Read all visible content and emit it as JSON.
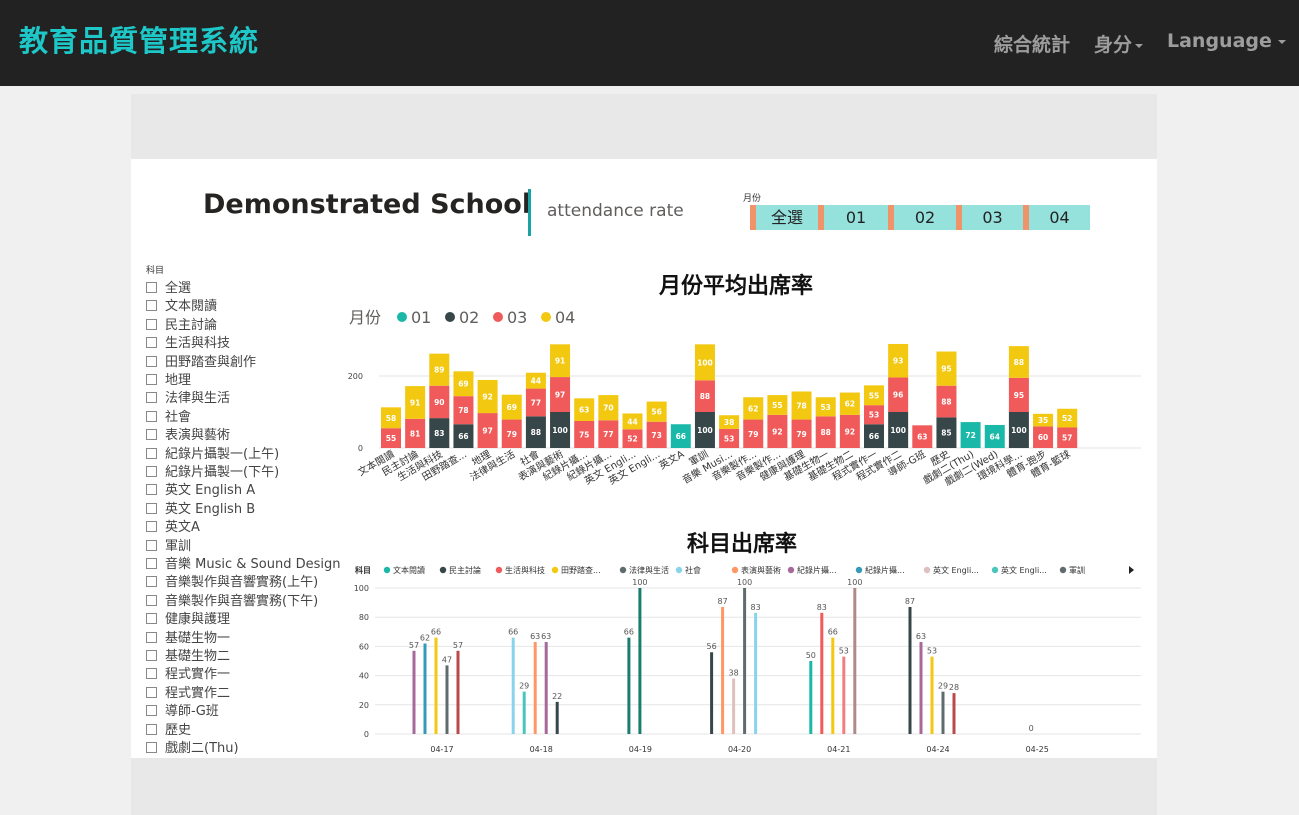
{
  "header": {
    "brand": "教育品質管理系統",
    "nav": [
      "綜合統計",
      "身分",
      "Language"
    ]
  },
  "report": {
    "school": "Demonstrated School",
    "subtitle": "attendance rate",
    "month_slicer": {
      "label": "月份",
      "options": [
        "全選",
        "01",
        "02",
        "03",
        "04"
      ]
    },
    "subject_slicer": {
      "label": "科目",
      "items": [
        "全選",
        "文本閱讀",
        "民主討論",
        "生活與科技",
        "田野踏查與創作",
        "地理",
        "法律與生活",
        "社會",
        "表演與藝術",
        "紀錄片攝製一(上午)",
        "紀錄片攝製一(下午)",
        "英文 English A",
        "英文 English B",
        "英文A",
        "軍訓",
        "音樂 Music & Sound Design",
        "音樂製作與音響實務(上午)",
        "音樂製作與音響實務(下午)",
        "健康與護理",
        "基礎生物一",
        "基礎生物二",
        "程式實作一",
        "程式實作二",
        "導師-G班",
        "歷史",
        "戲劇二(Thu)"
      ]
    }
  },
  "chart_data": [
    {
      "type": "bar",
      "stacked": true,
      "title": "月份平均出席率",
      "legend_title": "月份",
      "ylim": [
        0,
        300
      ],
      "yticks": [
        0,
        200
      ],
      "colors": {
        "01": "#1ab8a8",
        "02": "#374649",
        "03": "#f05a5a",
        "04": "#f2c811"
      },
      "categories": [
        "文本閱讀",
        "民主討論",
        "生活與科技",
        "田野踏查...",
        "地理",
        "法律與生活",
        "社會",
        "表演與藝術",
        "紀錄片攝...",
        "紀錄片攝...",
        "英文 Engli...",
        "英文 Engli...",
        "英文A",
        "軍訓",
        "音樂 Musi...",
        "音樂製作...",
        "音樂製作...",
        "健康與護理",
        "基礎生物一",
        "基礎生物二",
        "程式實作一",
        "程式實作二",
        "導師-G班",
        "歷史",
        "戲劇二(Thu)",
        "戲劇二(Wed)",
        "環境科學...",
        "體育-跑步",
        "體育-籃球"
      ],
      "series": [
        {
          "name": "01",
          "values": [
            null,
            null,
            null,
            null,
            null,
            null,
            null,
            null,
            null,
            null,
            null,
            null,
            66,
            null,
            null,
            null,
            null,
            null,
            null,
            null,
            null,
            null,
            null,
            null,
            72,
            64,
            null,
            null,
            null
          ]
        },
        {
          "name": "02",
          "values": [
            null,
            null,
            83,
            66,
            null,
            null,
            88,
            100,
            null,
            null,
            null,
            null,
            null,
            100,
            null,
            null,
            null,
            null,
            null,
            null,
            66,
            100,
            null,
            85,
            null,
            null,
            100,
            null,
            null
          ]
        },
        {
          "name": "03",
          "values": [
            55,
            81,
            90,
            78,
            97,
            79,
            77,
            97,
            75,
            77,
            52,
            73,
            null,
            88,
            53,
            79,
            92,
            79,
            88,
            92,
            53,
            96,
            63,
            88,
            null,
            null,
            95,
            60,
            57
          ]
        },
        {
          "name": "04",
          "values": [
            58,
            91,
            89,
            69,
            92,
            69,
            44,
            91,
            63,
            70,
            44,
            56,
            null,
            100,
            38,
            62,
            55,
            78,
            53,
            62,
            55,
            93,
            null,
            95,
            null,
            null,
            88,
            35,
            52
          ]
        }
      ]
    },
    {
      "type": "bar",
      "title": "科目出席率",
      "legend_title": "科目",
      "legend": [
        {
          "name": "文本閱讀",
          "color": "#1ab8a8"
        },
        {
          "name": "民主討論",
          "color": "#374649"
        },
        {
          "name": "生活與科技",
          "color": "#f05a5a"
        },
        {
          "name": "田野踏查...",
          "color": "#f2c811"
        },
        {
          "name": "法律與生活",
          "color": "#5f6b6d"
        },
        {
          "name": "社會",
          "color": "#8ad4eb"
        },
        {
          "name": "表演與藝術",
          "color": "#fe9666"
        },
        {
          "name": "紀錄片攝...",
          "color": "#a66999"
        },
        {
          "name": "紀錄片攝...",
          "color": "#3599b8"
        },
        {
          "name": "英文 Engli...",
          "color": "#dfbfbf"
        },
        {
          "name": "英文 Engli...",
          "color": "#4ac5bb"
        },
        {
          "name": "軍訓",
          "color": "#5f6b6d"
        }
      ],
      "ylim": [
        0,
        100
      ],
      "yticks": [
        0,
        20,
        40,
        60,
        80,
        100
      ],
      "categories": [
        "04-17",
        "04-18",
        "04-19",
        "04-20",
        "04-21",
        "04-24",
        "04-25"
      ],
      "bars": [
        {
          "day": "04-17",
          "value": 57,
          "color": "#a66999"
        },
        {
          "day": "04-17",
          "value": 62,
          "color": "#3599b8"
        },
        {
          "day": "04-17",
          "value": 66,
          "color": "#f2c811"
        },
        {
          "day": "04-17",
          "value": 47,
          "color": "#5f6b6d"
        },
        {
          "day": "04-17",
          "value": 57,
          "color": "#b84a4a"
        },
        {
          "day": "04-18",
          "value": 66,
          "color": "#8ad4eb"
        },
        {
          "day": "04-18",
          "value": 29,
          "color": "#4ac5bb"
        },
        {
          "day": "04-18",
          "value": 63,
          "color": "#fe9666"
        },
        {
          "day": "04-18",
          "value": 63,
          "color": "#a66999"
        },
        {
          "day": "04-18",
          "value": 22,
          "color": "#374649"
        },
        {
          "day": "04-19",
          "value": 66,
          "color": "#1a7d6e"
        },
        {
          "day": "04-19",
          "value": 100,
          "color": "#1a7d6e"
        },
        {
          "day": "04-20",
          "value": 56,
          "color": "#374649"
        },
        {
          "day": "04-20",
          "value": 87,
          "color": "#fe9666"
        },
        {
          "day": "04-20",
          "value": 38,
          "color": "#dfbfbf"
        },
        {
          "day": "04-20",
          "value": 100,
          "color": "#5f6b6d"
        },
        {
          "day": "04-20",
          "value": 83,
          "color": "#8ad4eb"
        },
        {
          "day": "04-21",
          "value": 50,
          "color": "#1ab8a8"
        },
        {
          "day": "04-21",
          "value": 83,
          "color": "#f05a5a"
        },
        {
          "day": "04-21",
          "value": 66,
          "color": "#f2c811"
        },
        {
          "day": "04-21",
          "value": 53,
          "color": "#f08080"
        },
        {
          "day": "04-21",
          "value": 100,
          "color": "#b08a8a"
        },
        {
          "day": "04-24",
          "value": 87,
          "color": "#374649"
        },
        {
          "day": "04-24",
          "value": 63,
          "color": "#a66999"
        },
        {
          "day": "04-24",
          "value": 53,
          "color": "#f2c811"
        },
        {
          "day": "04-24",
          "value": 29,
          "color": "#5f6b6d"
        },
        {
          "day": "04-24",
          "value": 28,
          "color": "#b84a4a"
        },
        {
          "day": "04-25",
          "value": 0,
          "color": "#374649"
        }
      ]
    }
  ]
}
